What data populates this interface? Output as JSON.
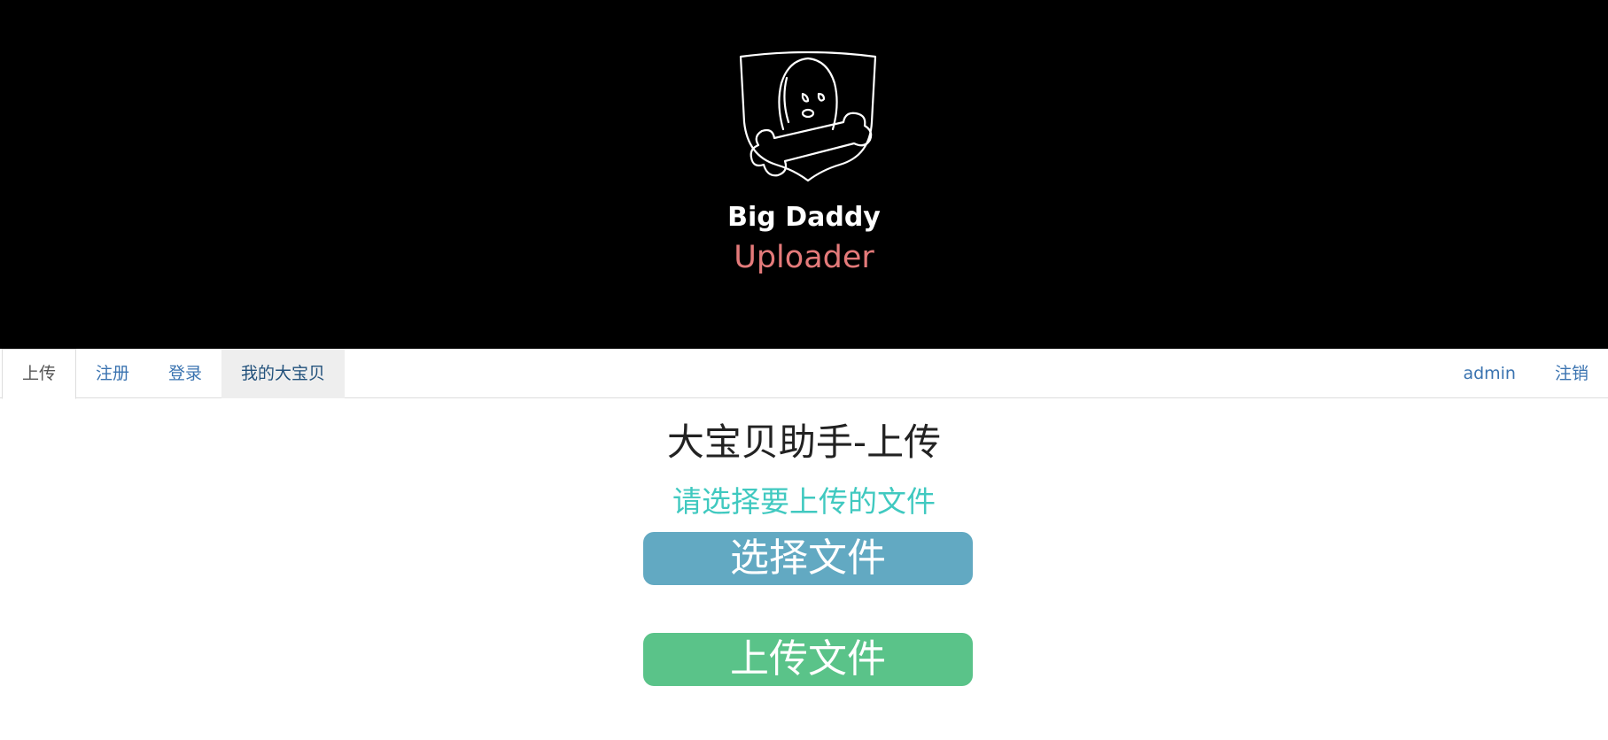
{
  "banner": {
    "logo_title": "Big Daddy",
    "logo_subtitle": "Uploader",
    "background_color": "#000000",
    "subtitle_color": "#e47a7a"
  },
  "nav": {
    "left_items": [
      {
        "label": "上传",
        "state": "active"
      },
      {
        "label": "注册",
        "state": "normal"
      },
      {
        "label": "登录",
        "state": "normal"
      },
      {
        "label": "我的大宝贝",
        "state": "hover"
      }
    ],
    "right_items": [
      {
        "label": "admin"
      },
      {
        "label": "注销"
      }
    ],
    "link_color": "#3a73b0"
  },
  "main": {
    "title": "大宝贝助手-上传",
    "prompt": "请选择要上传的文件",
    "prompt_color": "#40c9c0",
    "select_button_label": "选择文件",
    "select_button_color": "#62a9c2",
    "upload_button_label": "上传文件",
    "upload_button_color": "#5ac389"
  }
}
